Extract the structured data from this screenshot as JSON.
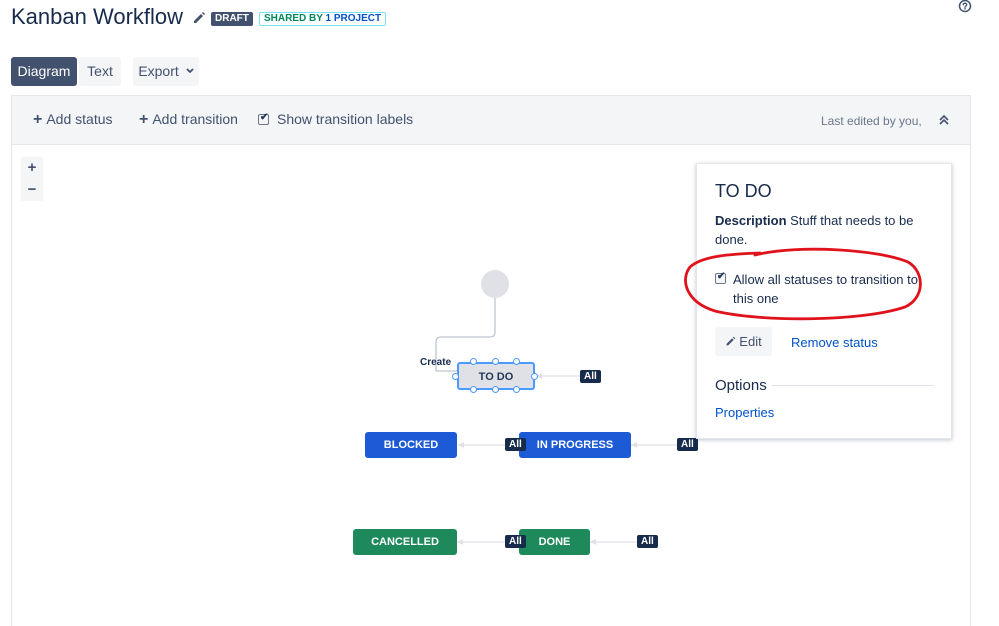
{
  "header": {
    "title": "Kanban Workflow",
    "draft_badge": "DRAFT",
    "shared_badge_prefix": "SHARED BY ",
    "shared_badge_link": "1 PROJECT"
  },
  "tabs": [
    {
      "label": "Diagram",
      "active": true
    },
    {
      "label": "Text",
      "active": false
    },
    {
      "label": "Export",
      "active": false
    }
  ],
  "toolbar": {
    "add_status": "Add status",
    "add_transition": "Add transition",
    "show_labels": "Show transition labels",
    "show_labels_checked": true,
    "last_edited": "Last edited by you,"
  },
  "zoom": {
    "in": "+",
    "out": "−"
  },
  "diagram": {
    "create_label": "Create",
    "all_label": "All",
    "nodes": {
      "todo": "TO DO",
      "in_progress": "IN PROGRESS",
      "blocked": "BLOCKED",
      "done": "DONE",
      "cancelled": "CANCELLED"
    }
  },
  "panel": {
    "title": "TO DO",
    "description_label": "Description",
    "description_text": " Stuff that needs to be done.",
    "allow_all_label": "Allow all statuses to transition to this one",
    "allow_all_checked": true,
    "edit_label": "Edit",
    "remove_label": "Remove status",
    "options_title": "Options",
    "properties_label": "Properties"
  },
  "colors": {
    "in_progress_category": "#1d5bd6",
    "done_category": "#1e8a5c",
    "todo_category": "#dfe1e6",
    "annotation": "#e0121b"
  }
}
